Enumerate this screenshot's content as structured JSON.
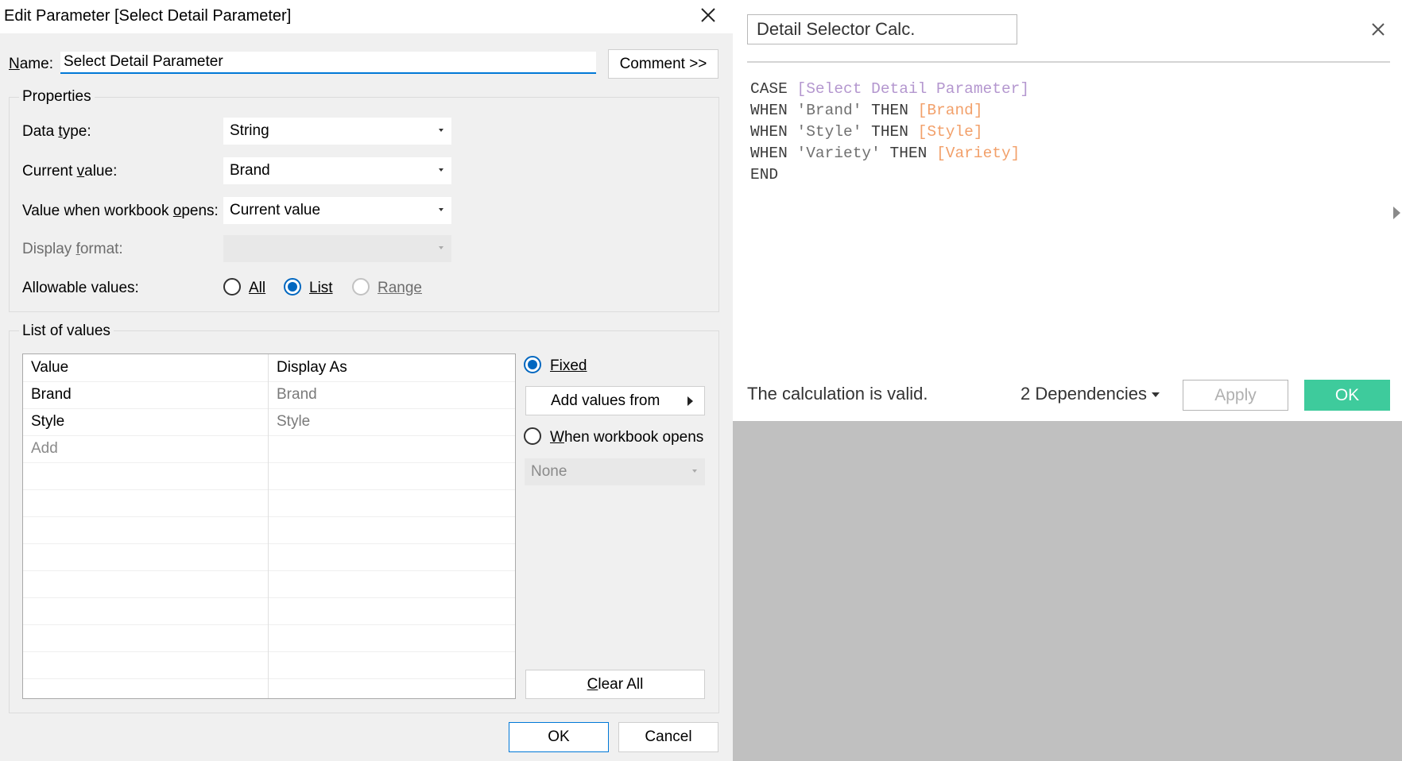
{
  "param_dialog": {
    "title": "Edit Parameter [Select Detail Parameter]",
    "name_label": "Name:",
    "name_value": "Select Detail Parameter",
    "comment_button": "Comment >>",
    "properties": {
      "group_title": "Properties",
      "data_type_label": "Data type:",
      "data_type_value": "String",
      "current_value_label": "Current value:",
      "current_value_value": "Brand",
      "workbook_opens_label": "Value when workbook opens:",
      "workbook_opens_value": "Current value",
      "display_format_label": "Display format:",
      "display_format_value": "",
      "allowable_label": "Allowable values:",
      "allowable_options": [
        "All",
        "List",
        "Range"
      ],
      "allowable_selected": "List"
    },
    "list_of_values": {
      "group_title": "List of values",
      "columns": [
        "Value",
        "Display As"
      ],
      "rows": [
        {
          "value": "Brand",
          "display": "Brand"
        },
        {
          "value": "Style",
          "display": "Style"
        }
      ],
      "add_placeholder": "Add",
      "fixed_label": "Fixed",
      "add_values_from": "Add values from",
      "when_workbook_opens_label": "When workbook opens",
      "when_workbook_opens_value": "None",
      "clear_all": "Clear All"
    },
    "ok_button": "OK",
    "cancel_button": "Cancel"
  },
  "calc_panel": {
    "calc_name": "Detail Selector Calc.",
    "code": {
      "line1": {
        "kw": "CASE",
        "param": "[Select Detail Parameter]"
      },
      "line2": {
        "kw1": "WHEN",
        "str": "'Brand'",
        "kw2": "THEN",
        "field": "[Brand]"
      },
      "line3": {
        "kw1": "WHEN",
        "str": "'Style'",
        "kw2": "THEN",
        "field": "[Style]"
      },
      "line4": {
        "kw1": "WHEN",
        "str": "'Variety'",
        "kw2": "THEN",
        "field": "[Variety]"
      },
      "line5": {
        "kw": "END"
      }
    },
    "status": "The calculation is valid.",
    "dependencies": "2 Dependencies",
    "apply_button": "Apply",
    "ok_button": "OK",
    "colors": {
      "ok_button": "#3ecb9c",
      "parameter": "#b497cf",
      "field": "#f2a06a",
      "string": "#707070"
    }
  }
}
